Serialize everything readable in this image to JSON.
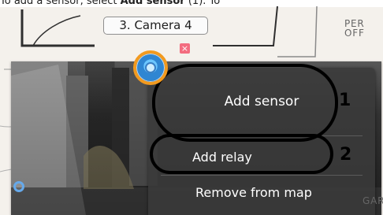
{
  "caption": {
    "prefix": "To add a sensor, select ",
    "bold": "Add sensor",
    "suffix": " (1). To"
  },
  "map": {
    "camera_label": "3. Camera 4",
    "text_per": "PER",
    "text_off": "OFF",
    "text_gar": "GAR",
    "close_symbol": "×",
    "marker_icon": "camera-marker-icon"
  },
  "menu": {
    "items": [
      {
        "label": "Add sensor"
      },
      {
        "label": "Add relay"
      },
      {
        "label": "Remove from map"
      }
    ]
  },
  "annotations": {
    "labels": [
      "1",
      "2"
    ]
  },
  "colors": {
    "panel": "#3a3a3a",
    "marker_ring": "#f29a1f",
    "marker_fill": "#2f86d2",
    "close_badge": "#f36c7f",
    "annotation": "#000000"
  }
}
